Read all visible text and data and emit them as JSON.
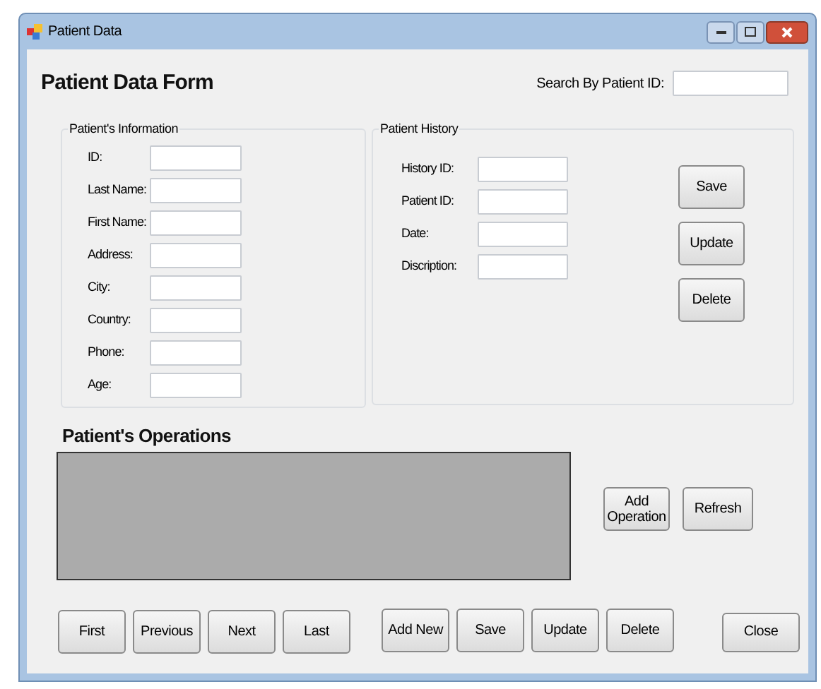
{
  "window": {
    "title": "Patient Data"
  },
  "heading": "Patient Data Form",
  "search": {
    "label": "Search By Patient ID:"
  },
  "patient_information": {
    "title": "Patient's Information",
    "fields": [
      {
        "label": "ID:"
      },
      {
        "label": "Last Name:"
      },
      {
        "label": "First Name:"
      },
      {
        "label": "Address:"
      },
      {
        "label": "City:"
      },
      {
        "label": "Country:"
      },
      {
        "label": "Phone:"
      },
      {
        "label": "Age:"
      }
    ]
  },
  "patient_history": {
    "title": "Patient History",
    "fields": [
      {
        "label": "History ID:"
      },
      {
        "label": "Patient ID:"
      },
      {
        "label": "Date:"
      },
      {
        "label": "Discription:"
      }
    ],
    "buttons": [
      "Save",
      "Update",
      "Delete"
    ]
  },
  "operations": {
    "title": "Patient's Operations",
    "buttons": [
      "Add Operation",
      "Refresh"
    ]
  },
  "navigation_buttons": [
    "First",
    "Previous",
    "Next",
    "Last"
  ],
  "record_buttons": [
    "Add New",
    "Save",
    "Update",
    "Delete"
  ],
  "close_button": "Close"
}
